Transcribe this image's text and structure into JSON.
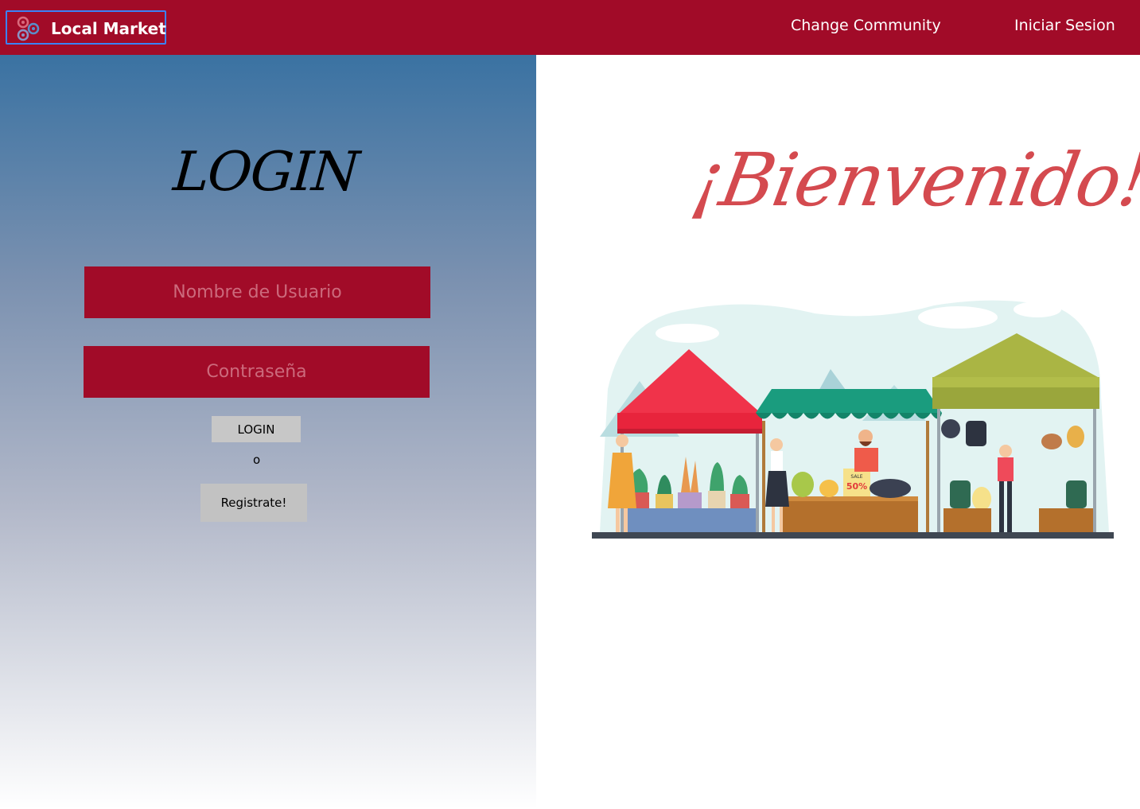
{
  "navbar": {
    "brand": "Local Market",
    "links": [
      {
        "label": "Change Community"
      },
      {
        "label": "Iniciar Sesion"
      }
    ]
  },
  "login": {
    "title": "LOGIN",
    "username_placeholder": "Nombre de Usuario",
    "password_placeholder": "Contraseña",
    "login_button": "LOGIN",
    "or_text": "o",
    "register_button": "Registrate!"
  },
  "welcome": {
    "title": "¡Bienvenido!",
    "illustration": {
      "sale_tag_top": "SALE",
      "sale_tag_value": "50%"
    }
  },
  "colors": {
    "brand_red": "#a10b28",
    "gradient_top": "#3a72a2",
    "welcome_red": "#d44a4f",
    "focus_outline": "#3b82f6"
  },
  "icons": {
    "brand": "local-market-logo-icon"
  }
}
